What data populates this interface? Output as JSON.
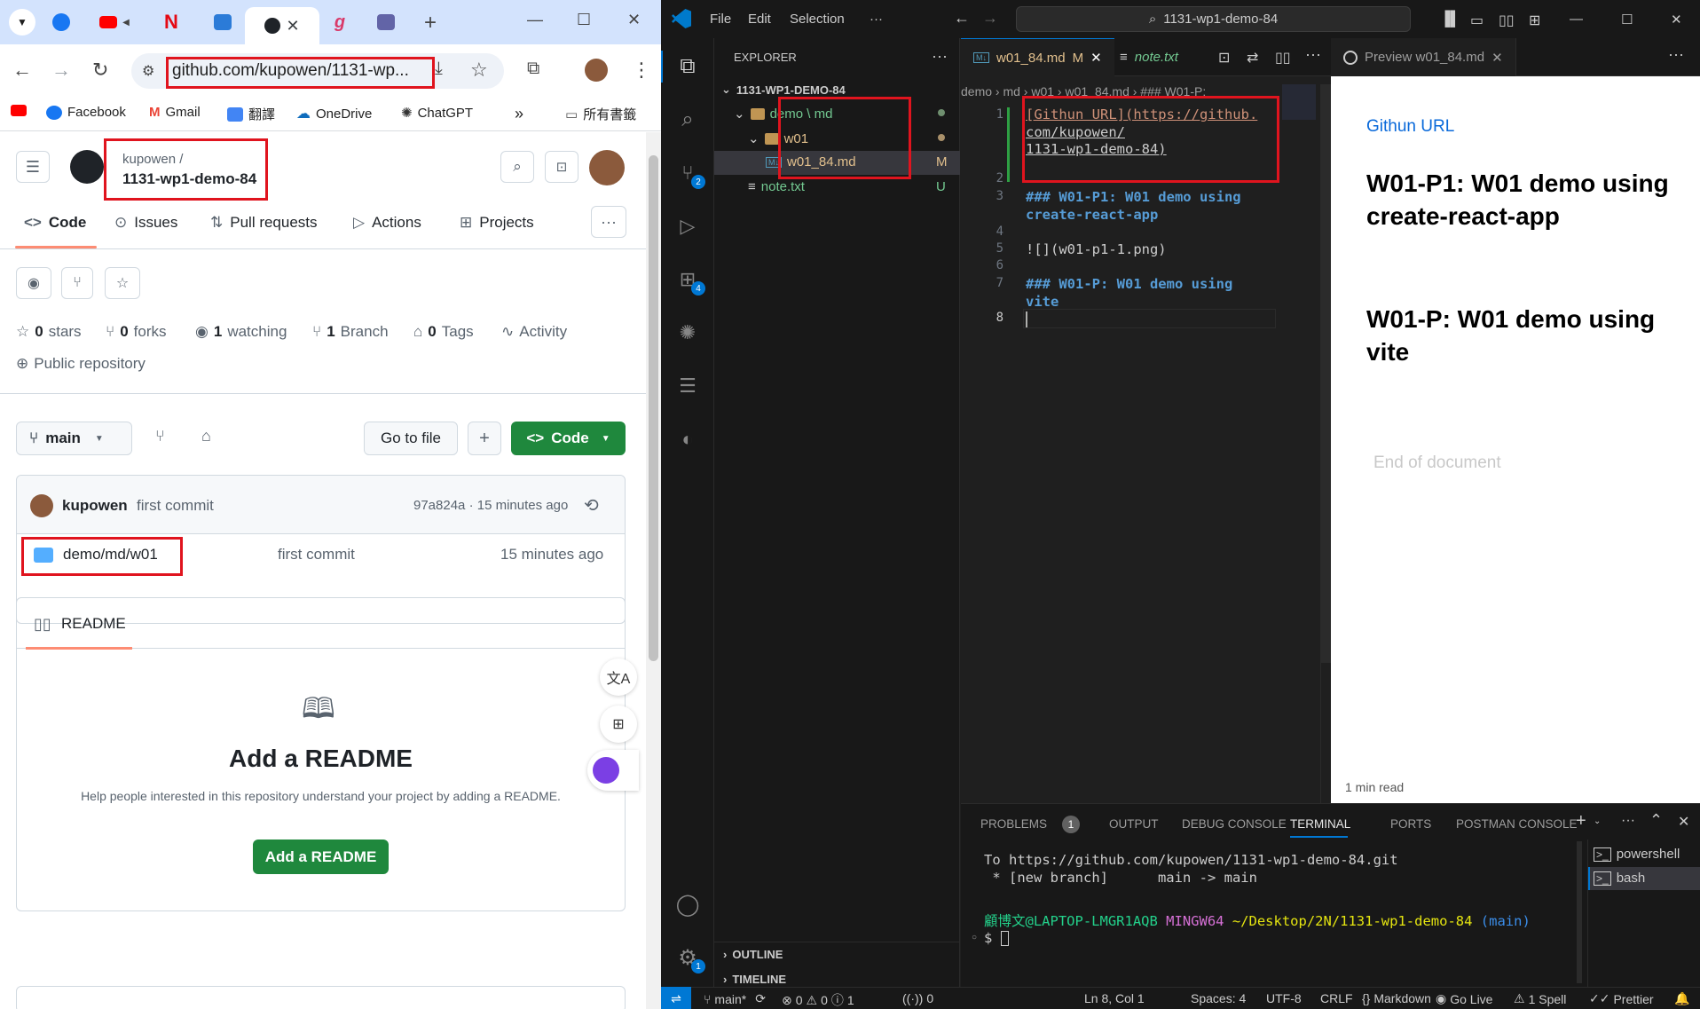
{
  "chrome": {
    "tabs": [
      {
        "name": "tab-facebook",
        "color": "#1877f2"
      },
      {
        "name": "tab-youtube",
        "color": "#ff0000"
      },
      {
        "name": "tab-netflix",
        "color": "#e50914"
      },
      {
        "name": "tab-teams-1",
        "color": "#2b7bd8"
      },
      {
        "name": "tab-github",
        "color": "#1f2328"
      },
      {
        "name": "tab-ai",
        "color": "#d93a6a"
      },
      {
        "name": "tab-teams-2",
        "color": "#6264a7"
      }
    ],
    "url": "github.com/kupowen/1131-wp...",
    "bookmarks": [
      {
        "label": ""
      },
      {
        "label": "Facebook"
      },
      {
        "label": "Gmail"
      },
      {
        "label": "翻譯"
      },
      {
        "label": "OneDrive"
      },
      {
        "label": "ChatGPT"
      }
    ],
    "bookmarks_more": "»",
    "all_bookmarks": "所有書籤"
  },
  "github": {
    "owner": "kupowen /",
    "repo": "1131-wp1-demo-84",
    "nav": {
      "code": "Code",
      "issues": "Issues",
      "pulls": "Pull requests",
      "actions": "Actions",
      "projects": "Projects"
    },
    "stats": {
      "stars_count": "0",
      "stars_label": "stars",
      "forks_count": "0",
      "forks_label": "forks",
      "watching_count": "1",
      "watching_label": "watching",
      "branch_count": "1",
      "branch_label": "Branch",
      "tags_count": "0",
      "tags_label": "Tags",
      "activity": "Activity",
      "visibility": "Public repository"
    },
    "branch": "main",
    "go_to_file": "Go to file",
    "code_button": "Code",
    "commit": {
      "author": "kupowen",
      "message": "first commit",
      "hash_time": "97a824a · 15 minutes ago"
    },
    "file_row": {
      "name": "demo/md/w01",
      "message": "first commit",
      "time": "15 minutes ago"
    },
    "readme_tab": "README",
    "readme": {
      "title": "Add a README",
      "body": "Help people interested in this repository understand your project by adding a README.",
      "button": "Add a README"
    }
  },
  "vscode": {
    "menus": [
      "File",
      "Edit",
      "Selection",
      "···"
    ],
    "search": "1131-wp1-demo-84",
    "explorer_title": "EXPLORER",
    "root": "1131-WP1-DEMO-84",
    "tree": {
      "demo_md": "demo \\ md",
      "w01": "w01",
      "file_md": "w01_84.md",
      "file_md_status": "M",
      "file_txt": "note.txt",
      "file_txt_status": "U"
    },
    "outline": "OUTLINE",
    "timeline": "TIMELINE",
    "tabs": {
      "md": "w01_84.md",
      "md_status": "M",
      "txt": "note.txt",
      "preview": "Preview w01_84.md"
    },
    "breadcrumb": "demo › md › w01 › w01_84.md › ### W01-P:",
    "code_lines": [
      {
        "n": "1",
        "a": "[Githun URL](https://github.",
        "b": "com/kupowen/",
        "c": "1131-wp1-demo-84)"
      },
      {
        "n": "2"
      },
      {
        "n": "3",
        "a": "### W01-P1: W01 demo using",
        "b": "create-react-app"
      },
      {
        "n": "4"
      },
      {
        "n": "5",
        "a": "![](w01-p1-1.png)"
      },
      {
        "n": "6"
      },
      {
        "n": "7",
        "a": "### W01-P: W01 demo using",
        "b": "vite"
      },
      {
        "n": "8"
      }
    ],
    "preview": {
      "link": "Githun URL",
      "h3_1": "W01-P1: W01 demo using create-react-app",
      "h3_2": "W01-P: W01 demo using vite",
      "end": "End of document",
      "read": "1 min read"
    },
    "panel_tabs": {
      "problems": "PROBLEMS",
      "problems_count": "1",
      "output": "OUTPUT",
      "debug": "DEBUG CONSOLE",
      "terminal": "TERMINAL",
      "ports": "PORTS",
      "postman": "POSTMAN CONSOLE"
    },
    "terminal": {
      "line1": "To https://github.com/kupowen/1131-wp1-demo-84.git",
      "line2": " * [new branch]      main -> main",
      "prompt_user": "顧博文@LAPTOP-LMGR1AQB",
      "prompt_env": "MINGW64",
      "prompt_path": "~/Desktop/2N/1131-wp1-demo-84",
      "prompt_branch": "(main)",
      "prompt": "$"
    },
    "shells": [
      "powershell",
      "bash"
    ],
    "status": {
      "branch": "main*",
      "errors": "0",
      "warnings": "0",
      "info": "1",
      "ports": "0",
      "position": "Ln 8, Col 1",
      "spaces": "Spaces: 4",
      "encoding": "UTF-8",
      "eol": "CRLF",
      "language": "Markdown",
      "golive": "Go Live",
      "spell": "1 Spell",
      "prettier": "Prettier"
    }
  }
}
